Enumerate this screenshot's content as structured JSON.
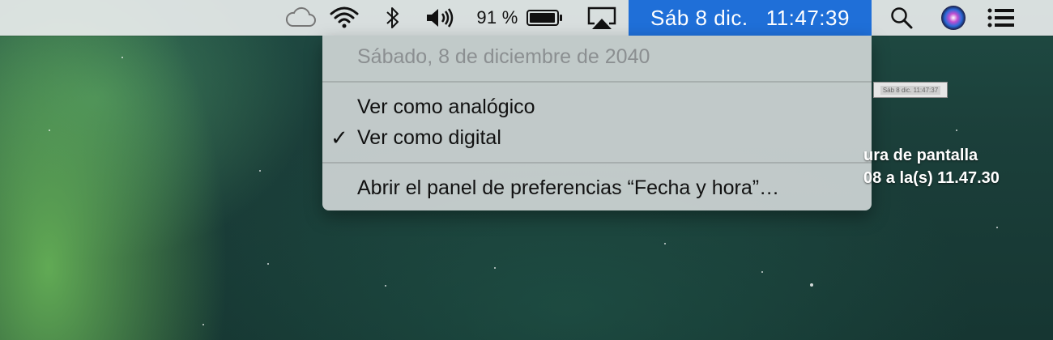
{
  "menubar": {
    "battery_percent": "91 %",
    "clock": {
      "date": "Sáb 8 dic.",
      "time": "11:47:39"
    },
    "icons": [
      "icloud-icon",
      "wifi-icon",
      "bluetooth-icon",
      "volume-icon",
      "battery-icon",
      "airplay-icon",
      "spotlight-search-icon",
      "siri-icon",
      "notification-center-icon"
    ]
  },
  "menu": {
    "header": "Sábado, 8 de diciembre de 2040",
    "items": [
      {
        "label": "Ver como analógico",
        "checked": false
      },
      {
        "label": "Ver como digital",
        "checked": true
      },
      {
        "label": "Abrir el panel de preferencias “Fecha y hora”…",
        "checked": false
      }
    ],
    "check_glyph": "✓"
  },
  "desktop": {
    "thumbnail_text": "Sáb 8 dic.  11:47:37",
    "file_label_line1": "ura de pantalla",
    "file_label_line2": "08 a la(s) 11.47.30"
  },
  "colors": {
    "highlight": "#1f6fd8",
    "menubar_bg": "#e8ecec",
    "menu_bg": "#cdd4d4"
  }
}
